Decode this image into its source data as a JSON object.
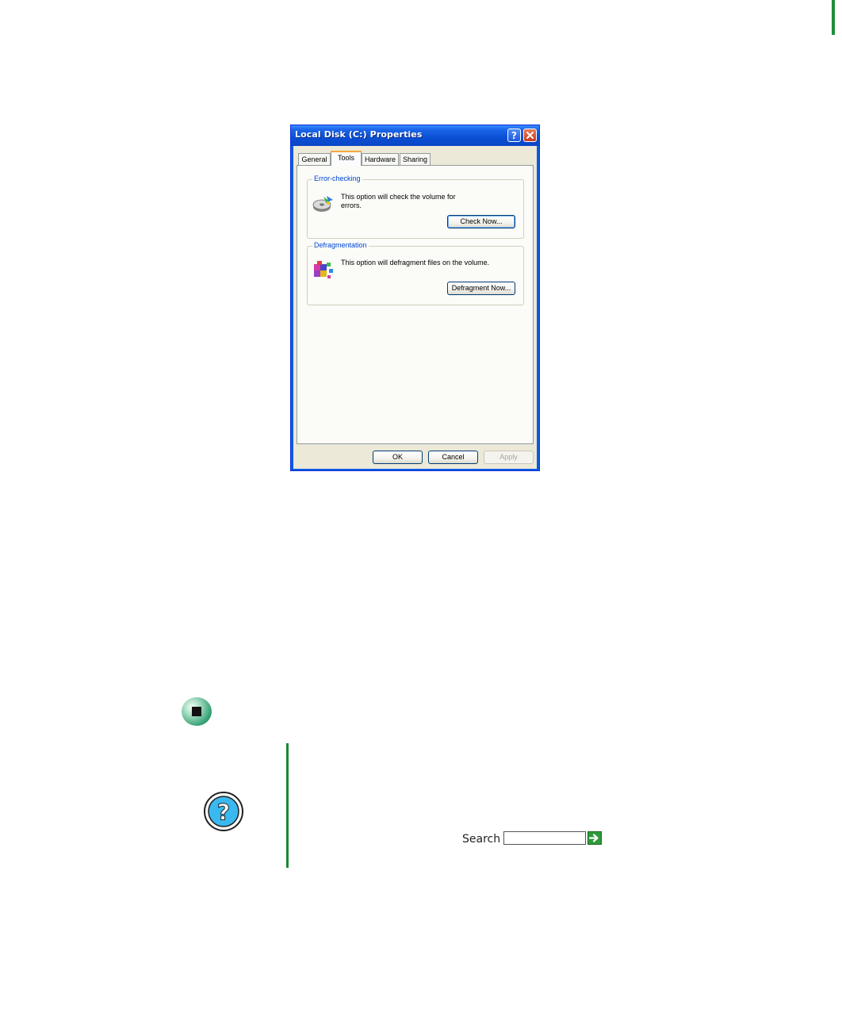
{
  "dialog": {
    "title": "Local Disk (C:) Properties",
    "help_button_glyph": "?",
    "tabs": [
      {
        "label": "General"
      },
      {
        "label": "Tools"
      },
      {
        "label": "Hardware"
      },
      {
        "label": "Sharing"
      }
    ],
    "active_tab": "Tools",
    "error_checking": {
      "heading": "Error-checking",
      "description": "This option will check the volume for errors.",
      "button_label": "Check Now...",
      "icon": "disk-check-icon"
    },
    "defragmentation": {
      "heading": "Defragmentation",
      "description": "This option will defragment files on the volume.",
      "button_label": "Defragment Now...",
      "icon": "defragment-icon"
    },
    "footer": {
      "ok_label": "OK",
      "cancel_label": "Cancel",
      "apply_label": "Apply"
    }
  },
  "help_panel": {
    "help_icon": "question-mark-icon",
    "search_label": "Search",
    "search_value": "",
    "go_icon": "green-arrow-icon"
  },
  "colors": {
    "titlebar": "#0a4fd4",
    "accent_green": "#138a2c",
    "tab_highlight": "#f5a73a",
    "group_label": "#0046d5"
  }
}
